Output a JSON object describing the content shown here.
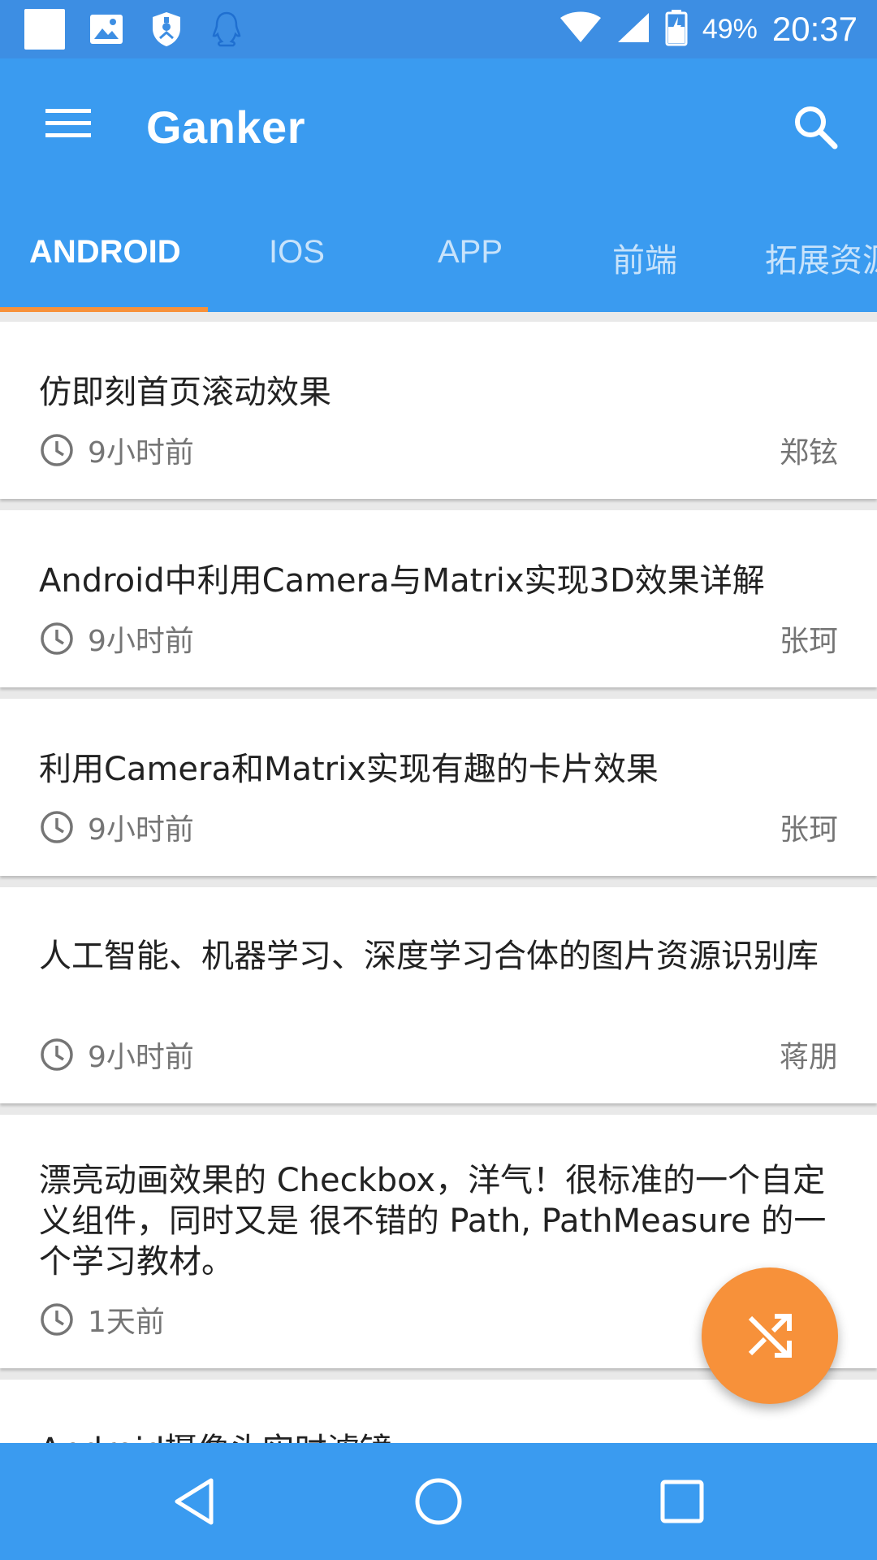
{
  "status_bar": {
    "battery_percent": "49%",
    "time": "20:37",
    "left_icons": [
      "square-notification-icon",
      "image-icon",
      "shield-icon",
      "qq-penguin-icon"
    ],
    "right_icons": [
      "wifi-icon",
      "signal-icon",
      "battery-icon"
    ]
  },
  "toolbar": {
    "title": "Ganker",
    "menu_icon": "hamburger-menu-icon",
    "search_icon": "search-icon"
  },
  "tabs": [
    {
      "label": "ANDROID",
      "active": true
    },
    {
      "label": "IOS",
      "active": false
    },
    {
      "label": "APP",
      "active": false
    },
    {
      "label": "前端",
      "active": false
    },
    {
      "label": "拓展资源",
      "active": false
    }
  ],
  "articles": [
    {
      "title": "仿即刻首页滚动效果",
      "time": "9小时前",
      "author": "郑铉"
    },
    {
      "title": "Android中利用Camera与Matrix实现3D效果详解",
      "time": "9小时前",
      "author": "张珂"
    },
    {
      "title": "利用Camera和Matrix实现有趣的卡片效果",
      "time": "9小时前",
      "author": "张珂"
    },
    {
      "title": "人工智能、机器学习、深度学习合体的图片资源识别库",
      "time": "9小时前",
      "author": "蒋朋"
    },
    {
      "title": "漂亮动画效果的 Checkbox，洋气！很标准的一个自定义组件，同时又是 很不错的 Path, PathMeasure 的一个学习教材。",
      "time": "1天前",
      "author": ""
    },
    {
      "title": "Android摄像头实时滤镜",
      "time": "",
      "author": ""
    }
  ],
  "fab": {
    "icon": "shuffle-icon",
    "color": "#f7913a"
  },
  "nav_bar": {
    "icons": [
      "back-icon",
      "home-icon",
      "recents-icon"
    ]
  },
  "colors": {
    "primary": "#3a9bf0",
    "status_bar": "#3d8ee3",
    "accent": "#f7913a"
  }
}
